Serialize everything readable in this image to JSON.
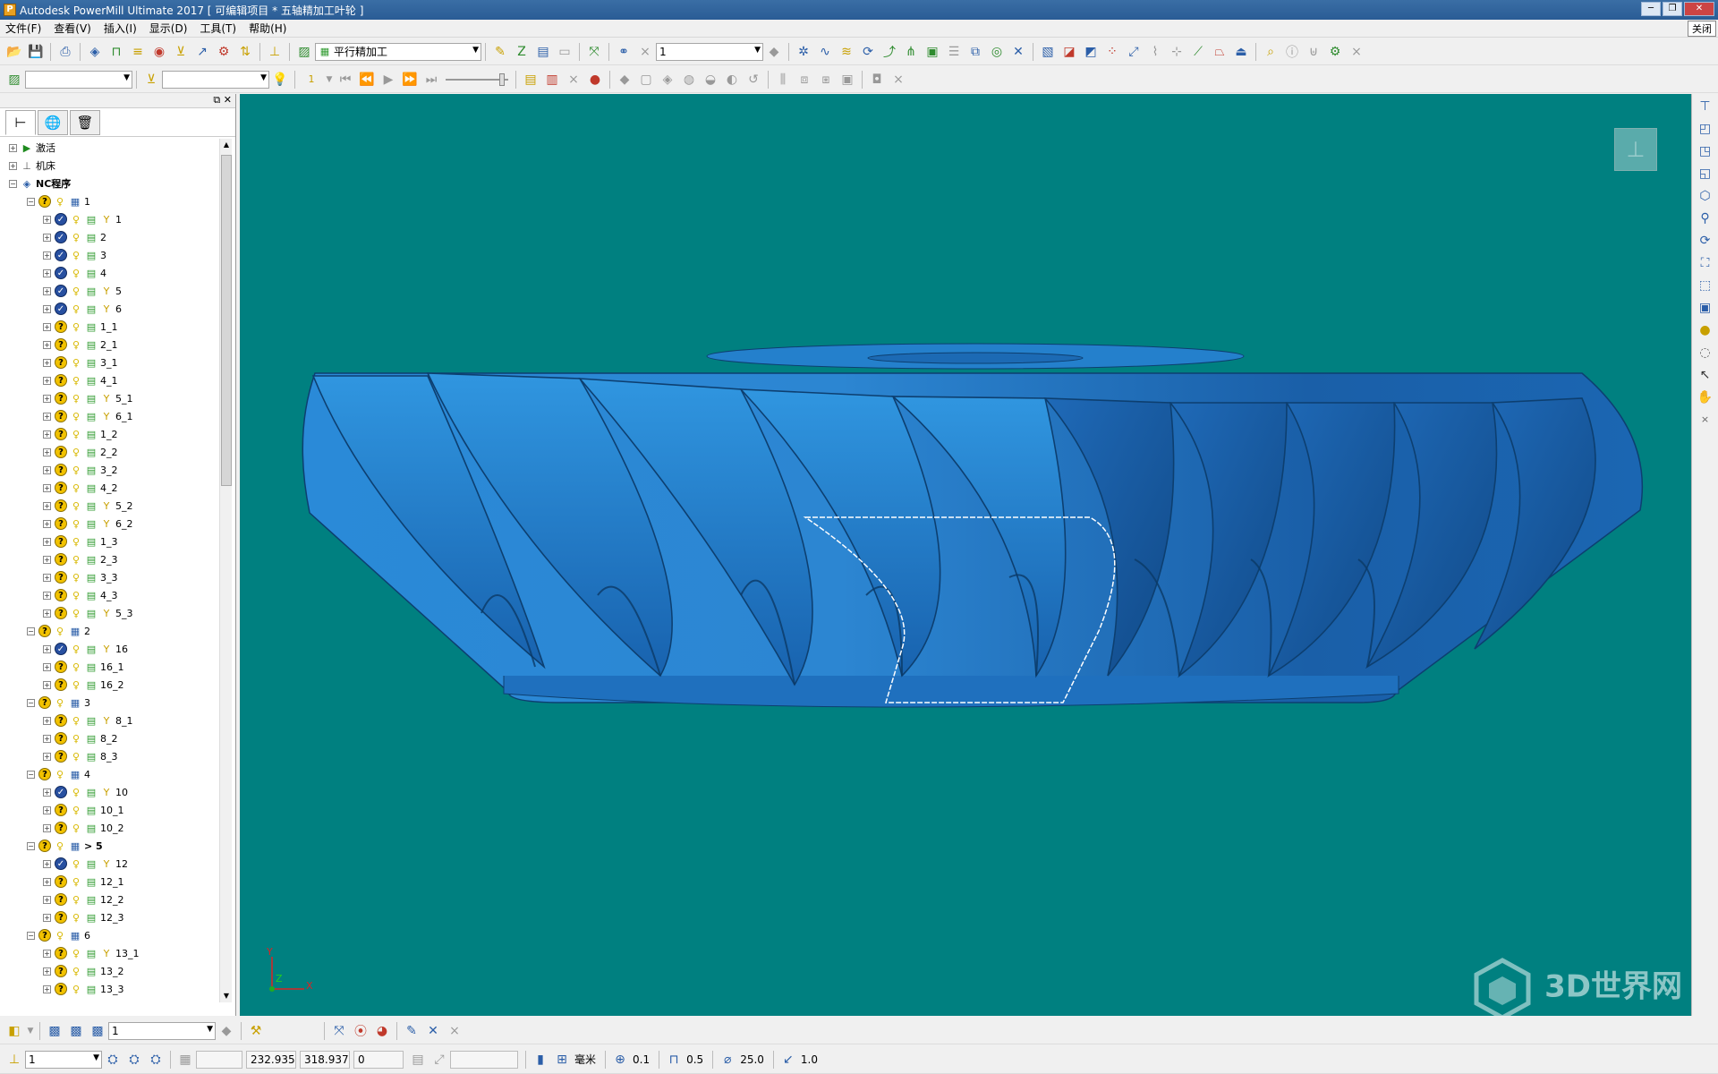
{
  "window": {
    "title": "Autodesk PowerMill Ultimate 2017    [ 可编辑项目 * 五轴精加工叶轮 ]",
    "close_label": "关闭"
  },
  "menu": [
    "文件(F)",
    "查看(V)",
    "插入(I)",
    "显示(D)",
    "工具(T)",
    "帮助(H)"
  ],
  "toolbar": {
    "strategy_combo": "平行精加工",
    "number_combo": "1"
  },
  "toolbar2": {
    "step_value": "1"
  },
  "explorer": {
    "top_items": [
      {
        "label": "激活",
        "icon": "activate-icon"
      },
      {
        "label": "机床",
        "icon": "machine-icon"
      },
      {
        "label": "NC程序",
        "icon": "nc-program-icon"
      }
    ],
    "groups": [
      {
        "label": "1",
        "items": [
          {
            "label": "1",
            "status": "ok",
            "tool": true
          },
          {
            "label": "2",
            "status": "ok",
            "tool": false
          },
          {
            "label": "3",
            "status": "ok",
            "tool": false
          },
          {
            "label": "4",
            "status": "ok",
            "tool": false
          },
          {
            "label": "5",
            "status": "ok",
            "tool": true
          },
          {
            "label": "6",
            "status": "ok",
            "tool": true
          },
          {
            "label": "1_1",
            "status": "q",
            "tool": false
          },
          {
            "label": "2_1",
            "status": "q",
            "tool": false
          },
          {
            "label": "3_1",
            "status": "q",
            "tool": false
          },
          {
            "label": "4_1",
            "status": "q",
            "tool": false
          },
          {
            "label": "5_1",
            "status": "q",
            "tool": true
          },
          {
            "label": "6_1",
            "status": "q",
            "tool": true
          },
          {
            "label": "1_2",
            "status": "q",
            "tool": false
          },
          {
            "label": "2_2",
            "status": "q",
            "tool": false
          },
          {
            "label": "3_2",
            "status": "q",
            "tool": false
          },
          {
            "label": "4_2",
            "status": "q",
            "tool": false
          },
          {
            "label": "5_2",
            "status": "q",
            "tool": true
          },
          {
            "label": "6_2",
            "status": "q",
            "tool": true
          },
          {
            "label": "1_3",
            "status": "q",
            "tool": false
          },
          {
            "label": "2_3",
            "status": "q",
            "tool": false
          },
          {
            "label": "3_3",
            "status": "q",
            "tool": false
          },
          {
            "label": "4_3",
            "status": "q",
            "tool": false
          },
          {
            "label": "5_3",
            "status": "q",
            "tool": true
          }
        ]
      },
      {
        "label": "2",
        "items": [
          {
            "label": "16",
            "status": "ok",
            "tool": true
          },
          {
            "label": "16_1",
            "status": "q",
            "tool": false
          },
          {
            "label": "16_2",
            "status": "q",
            "tool": false
          }
        ]
      },
      {
        "label": "3",
        "items": [
          {
            "label": "8_1",
            "status": "q",
            "tool": true
          },
          {
            "label": "8_2",
            "status": "q",
            "tool": false
          },
          {
            "label": "8_3",
            "status": "q",
            "tool": false
          }
        ]
      },
      {
        "label": "4",
        "items": [
          {
            "label": "10",
            "status": "ok",
            "tool": true
          },
          {
            "label": "10_1",
            "status": "q",
            "tool": false
          },
          {
            "label": "10_2",
            "status": "q",
            "tool": false
          }
        ]
      },
      {
        "label": "> 5",
        "active": true,
        "items": [
          {
            "label": "12",
            "status": "ok",
            "tool": true
          },
          {
            "label": "12_1",
            "status": "q",
            "tool": false
          },
          {
            "label": "12_2",
            "status": "q",
            "tool": false
          },
          {
            "label": "12_3",
            "status": "q",
            "tool": false
          }
        ]
      },
      {
        "label": "6",
        "items": [
          {
            "label": "13_1",
            "status": "q",
            "tool": true
          },
          {
            "label": "13_2",
            "status": "q",
            "tool": false
          },
          {
            "label": "13_3",
            "status": "q",
            "tool": false
          }
        ]
      }
    ]
  },
  "bottom_toolbar": {
    "combo": "1"
  },
  "status": {
    "layer_combo": "1",
    "x": "232.935",
    "y": "318.937",
    "z": "0",
    "units": "毫米",
    "tolerance": "0.1",
    "thickness": "0.5",
    "diameter": "25.0",
    "stepover": "1.0"
  },
  "watermark": "3D世界网",
  "axes": {
    "y": "Y",
    "z": "Z",
    "x": "X"
  },
  "colors": {
    "viewport_bg": "#008080",
    "part": "#1e78c8"
  }
}
